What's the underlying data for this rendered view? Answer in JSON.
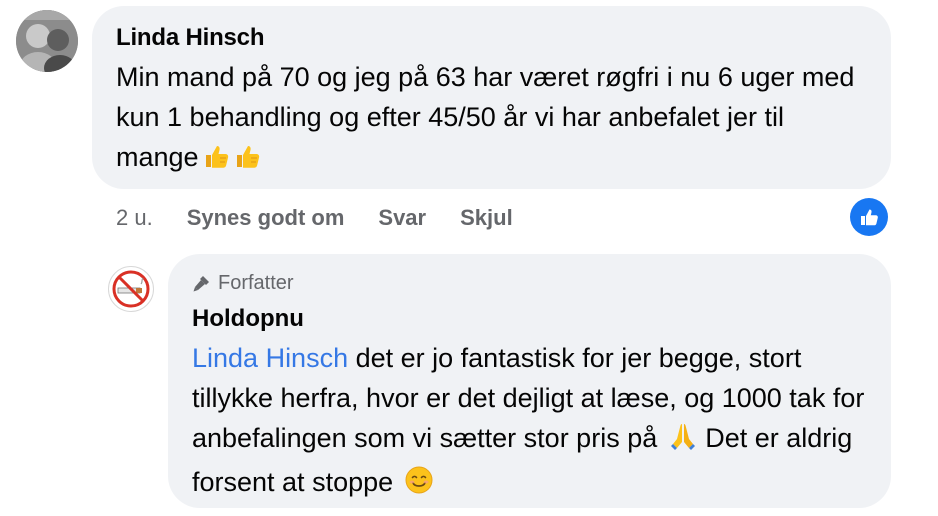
{
  "comment": {
    "author": "Linda Hinsch",
    "text": "Min mand på 70 og jeg på 63 har været røgfri i nu 6 uger med kun 1 behandling og efter 45/50 år vi har anbefalet jer til mange",
    "emojis": [
      "thumbs-up",
      "thumbs-up"
    ],
    "time": "2 u.",
    "actions": {
      "like": "Synes godt om",
      "reply": "Svar",
      "hide": "Skjul"
    },
    "reaction": "like"
  },
  "reply": {
    "badge": "Forfatter",
    "author": "Holdopnu",
    "mention": "Linda Hinsch",
    "text_part1": " det er jo fantastisk for jer begge, stort tillykke herfra, hvor er det dejligt at læse, og 1000 tak for anbefalingen som vi sætter stor pris på",
    "text_part2": " Det er aldrig forsent at stoppe",
    "emojis": [
      "folded-hands",
      "smiling-face"
    ]
  },
  "colors": {
    "bubble": "#f0f2f5",
    "secondary_text": "#65676b",
    "mention": "#3578e5",
    "like_blue": "#1877f2"
  }
}
